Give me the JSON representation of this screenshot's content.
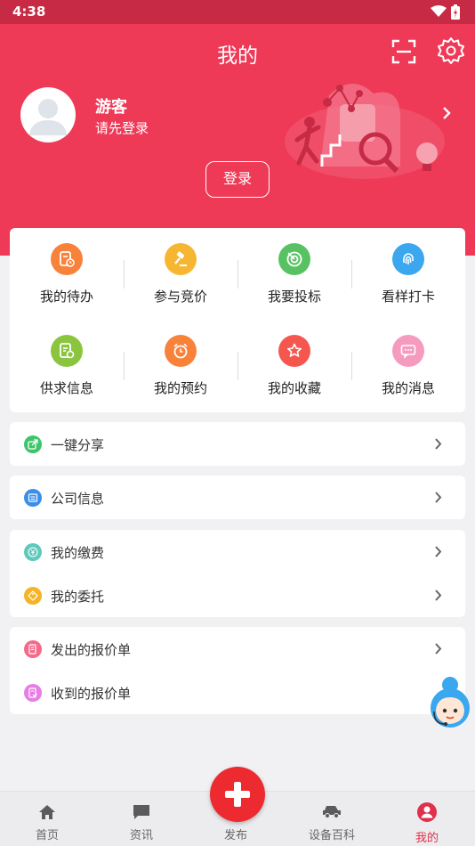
{
  "status_bar": {
    "time": "4:38"
  },
  "header": {
    "title": "我的",
    "user_name": "游客",
    "user_subtitle": "请先登录",
    "login_label": "登录",
    "background_color": "#ee3a57"
  },
  "quick_actions": [
    {
      "label": "我的待办",
      "icon": "document-clock-icon",
      "color": "#f8823a"
    },
    {
      "label": "参与竞价",
      "icon": "gavel-icon",
      "color": "#f7b631"
    },
    {
      "label": "我要投标",
      "icon": "target-icon",
      "color": "#58c262"
    },
    {
      "label": "看样打卡",
      "icon": "fingerprint-icon",
      "color": "#3aa7ee"
    },
    {
      "label": "供求信息",
      "icon": "document-gear-icon",
      "color": "#8bc53f"
    },
    {
      "label": "我的预约",
      "icon": "alarm-clock-icon",
      "color": "#f8823a"
    },
    {
      "label": "我的收藏",
      "icon": "star-icon",
      "color": "#f5574e"
    },
    {
      "label": "我的消息",
      "icon": "chat-icon",
      "color": "#f59bbd"
    }
  ],
  "menu_groups": [
    [
      {
        "label": "一键分享",
        "icon": "share-icon",
        "color": "#3cc56a",
        "chevron": true
      }
    ],
    [
      {
        "label": "公司信息",
        "icon": "company-icon",
        "color": "#3a8fea",
        "chevron": true
      }
    ],
    [
      {
        "label": "我的缴费",
        "icon": "yen-icon",
        "color": "#5ec9bc",
        "chevron": true
      },
      {
        "label": "我的委托",
        "icon": "tag-icon",
        "color": "#f5b326",
        "chevron": true
      }
    ],
    [
      {
        "label": "发出的报价单",
        "icon": "quote-sent-icon",
        "color": "#f56a8a",
        "chevron": true
      },
      {
        "label": "收到的报价单",
        "icon": "quote-received-icon",
        "color": "#e77de5",
        "chevron": false
      }
    ]
  ],
  "bottom_nav": [
    {
      "label": "首页",
      "icon": "home-icon",
      "active": false
    },
    {
      "label": "资讯",
      "icon": "news-icon",
      "active": false
    },
    {
      "label": "发布",
      "icon": "plus-icon",
      "active": false
    },
    {
      "label": "设备百科",
      "icon": "car-icon",
      "active": false
    },
    {
      "label": "我的",
      "icon": "person-icon",
      "active": true
    }
  ],
  "accent_color": "#e0304c"
}
